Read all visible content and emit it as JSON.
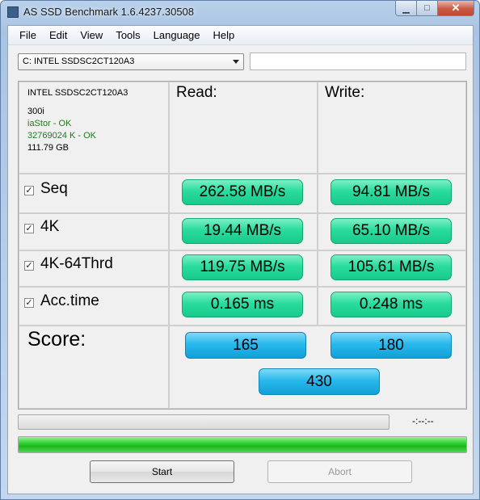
{
  "window": {
    "title": "AS SSD Benchmark 1.6.4237.30508"
  },
  "menu": [
    "File",
    "Edit",
    "View",
    "Tools",
    "Language",
    "Help"
  ],
  "drive": {
    "selected": "C: INTEL SSDSC2CT120A3"
  },
  "info": {
    "model": "INTEL SSDSC2CT120A3",
    "firmware": "300i",
    "driver_status": "iaStor - OK",
    "alignment_status": "32769024 K - OK",
    "capacity": "111.79 GB"
  },
  "headers": {
    "read": "Read:",
    "write": "Write:"
  },
  "tests": [
    {
      "label": "Seq",
      "checked": true,
      "read": "262.58 MB/s",
      "write": "94.81 MB/s"
    },
    {
      "label": "4K",
      "checked": true,
      "read": "19.44 MB/s",
      "write": "65.10 MB/s"
    },
    {
      "label": "4K-64Thrd",
      "checked": true,
      "read": "119.75 MB/s",
      "write": "105.61 MB/s"
    },
    {
      "label": "Acc.time",
      "checked": true,
      "read": "0.165 ms",
      "write": "0.248 ms"
    }
  ],
  "score": {
    "label": "Score:",
    "read": "165",
    "write": "180",
    "total": "430"
  },
  "status": {
    "time": "-:--:--",
    "progress_fraction": 1.0
  },
  "buttons": {
    "start": "Start",
    "abort": "Abort"
  },
  "colors": {
    "result_green": "#29dc9d",
    "score_blue": "#28b9ec",
    "progress_green": "#31d231",
    "status_ok_text": "#1e7d1e"
  },
  "icons": {
    "checkbox": "check-mark",
    "dropdown": "chevron-down-icon"
  }
}
